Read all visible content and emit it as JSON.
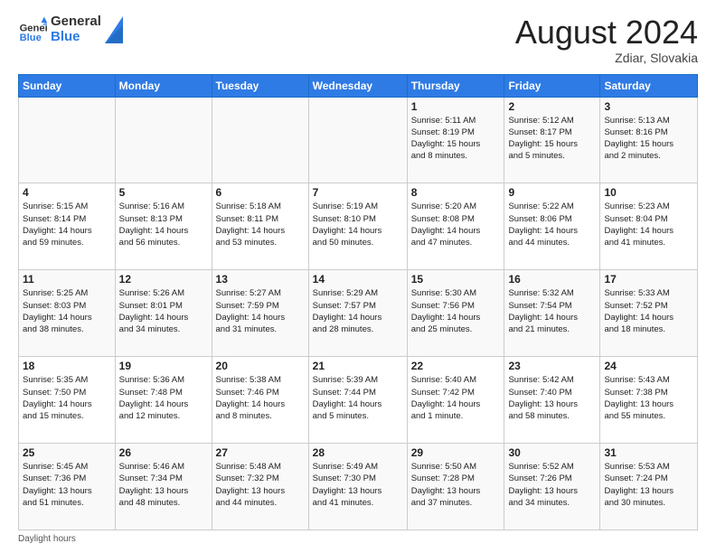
{
  "header": {
    "logo_line1": "General",
    "logo_line2": "Blue",
    "month": "August 2024",
    "location": "Zdiar, Slovakia"
  },
  "days_of_week": [
    "Sunday",
    "Monday",
    "Tuesday",
    "Wednesday",
    "Thursday",
    "Friday",
    "Saturday"
  ],
  "weeks": [
    [
      {
        "day": "",
        "info": ""
      },
      {
        "day": "",
        "info": ""
      },
      {
        "day": "",
        "info": ""
      },
      {
        "day": "",
        "info": ""
      },
      {
        "day": "1",
        "info": "Sunrise: 5:11 AM\nSunset: 8:19 PM\nDaylight: 15 hours\nand 8 minutes."
      },
      {
        "day": "2",
        "info": "Sunrise: 5:12 AM\nSunset: 8:17 PM\nDaylight: 15 hours\nand 5 minutes."
      },
      {
        "day": "3",
        "info": "Sunrise: 5:13 AM\nSunset: 8:16 PM\nDaylight: 15 hours\nand 2 minutes."
      }
    ],
    [
      {
        "day": "4",
        "info": "Sunrise: 5:15 AM\nSunset: 8:14 PM\nDaylight: 14 hours\nand 59 minutes."
      },
      {
        "day": "5",
        "info": "Sunrise: 5:16 AM\nSunset: 8:13 PM\nDaylight: 14 hours\nand 56 minutes."
      },
      {
        "day": "6",
        "info": "Sunrise: 5:18 AM\nSunset: 8:11 PM\nDaylight: 14 hours\nand 53 minutes."
      },
      {
        "day": "7",
        "info": "Sunrise: 5:19 AM\nSunset: 8:10 PM\nDaylight: 14 hours\nand 50 minutes."
      },
      {
        "day": "8",
        "info": "Sunrise: 5:20 AM\nSunset: 8:08 PM\nDaylight: 14 hours\nand 47 minutes."
      },
      {
        "day": "9",
        "info": "Sunrise: 5:22 AM\nSunset: 8:06 PM\nDaylight: 14 hours\nand 44 minutes."
      },
      {
        "day": "10",
        "info": "Sunrise: 5:23 AM\nSunset: 8:04 PM\nDaylight: 14 hours\nand 41 minutes."
      }
    ],
    [
      {
        "day": "11",
        "info": "Sunrise: 5:25 AM\nSunset: 8:03 PM\nDaylight: 14 hours\nand 38 minutes."
      },
      {
        "day": "12",
        "info": "Sunrise: 5:26 AM\nSunset: 8:01 PM\nDaylight: 14 hours\nand 34 minutes."
      },
      {
        "day": "13",
        "info": "Sunrise: 5:27 AM\nSunset: 7:59 PM\nDaylight: 14 hours\nand 31 minutes."
      },
      {
        "day": "14",
        "info": "Sunrise: 5:29 AM\nSunset: 7:57 PM\nDaylight: 14 hours\nand 28 minutes."
      },
      {
        "day": "15",
        "info": "Sunrise: 5:30 AM\nSunset: 7:56 PM\nDaylight: 14 hours\nand 25 minutes."
      },
      {
        "day": "16",
        "info": "Sunrise: 5:32 AM\nSunset: 7:54 PM\nDaylight: 14 hours\nand 21 minutes."
      },
      {
        "day": "17",
        "info": "Sunrise: 5:33 AM\nSunset: 7:52 PM\nDaylight: 14 hours\nand 18 minutes."
      }
    ],
    [
      {
        "day": "18",
        "info": "Sunrise: 5:35 AM\nSunset: 7:50 PM\nDaylight: 14 hours\nand 15 minutes."
      },
      {
        "day": "19",
        "info": "Sunrise: 5:36 AM\nSunset: 7:48 PM\nDaylight: 14 hours\nand 12 minutes."
      },
      {
        "day": "20",
        "info": "Sunrise: 5:38 AM\nSunset: 7:46 PM\nDaylight: 14 hours\nand 8 minutes."
      },
      {
        "day": "21",
        "info": "Sunrise: 5:39 AM\nSunset: 7:44 PM\nDaylight: 14 hours\nand 5 minutes."
      },
      {
        "day": "22",
        "info": "Sunrise: 5:40 AM\nSunset: 7:42 PM\nDaylight: 14 hours\nand 1 minute."
      },
      {
        "day": "23",
        "info": "Sunrise: 5:42 AM\nSunset: 7:40 PM\nDaylight: 13 hours\nand 58 minutes."
      },
      {
        "day": "24",
        "info": "Sunrise: 5:43 AM\nSunset: 7:38 PM\nDaylight: 13 hours\nand 55 minutes."
      }
    ],
    [
      {
        "day": "25",
        "info": "Sunrise: 5:45 AM\nSunset: 7:36 PM\nDaylight: 13 hours\nand 51 minutes."
      },
      {
        "day": "26",
        "info": "Sunrise: 5:46 AM\nSunset: 7:34 PM\nDaylight: 13 hours\nand 48 minutes."
      },
      {
        "day": "27",
        "info": "Sunrise: 5:48 AM\nSunset: 7:32 PM\nDaylight: 13 hours\nand 44 minutes."
      },
      {
        "day": "28",
        "info": "Sunrise: 5:49 AM\nSunset: 7:30 PM\nDaylight: 13 hours\nand 41 minutes."
      },
      {
        "day": "29",
        "info": "Sunrise: 5:50 AM\nSunset: 7:28 PM\nDaylight: 13 hours\nand 37 minutes."
      },
      {
        "day": "30",
        "info": "Sunrise: 5:52 AM\nSunset: 7:26 PM\nDaylight: 13 hours\nand 34 minutes."
      },
      {
        "day": "31",
        "info": "Sunrise: 5:53 AM\nSunset: 7:24 PM\nDaylight: 13 hours\nand 30 minutes."
      }
    ]
  ],
  "footer": {
    "note": "Daylight hours"
  }
}
